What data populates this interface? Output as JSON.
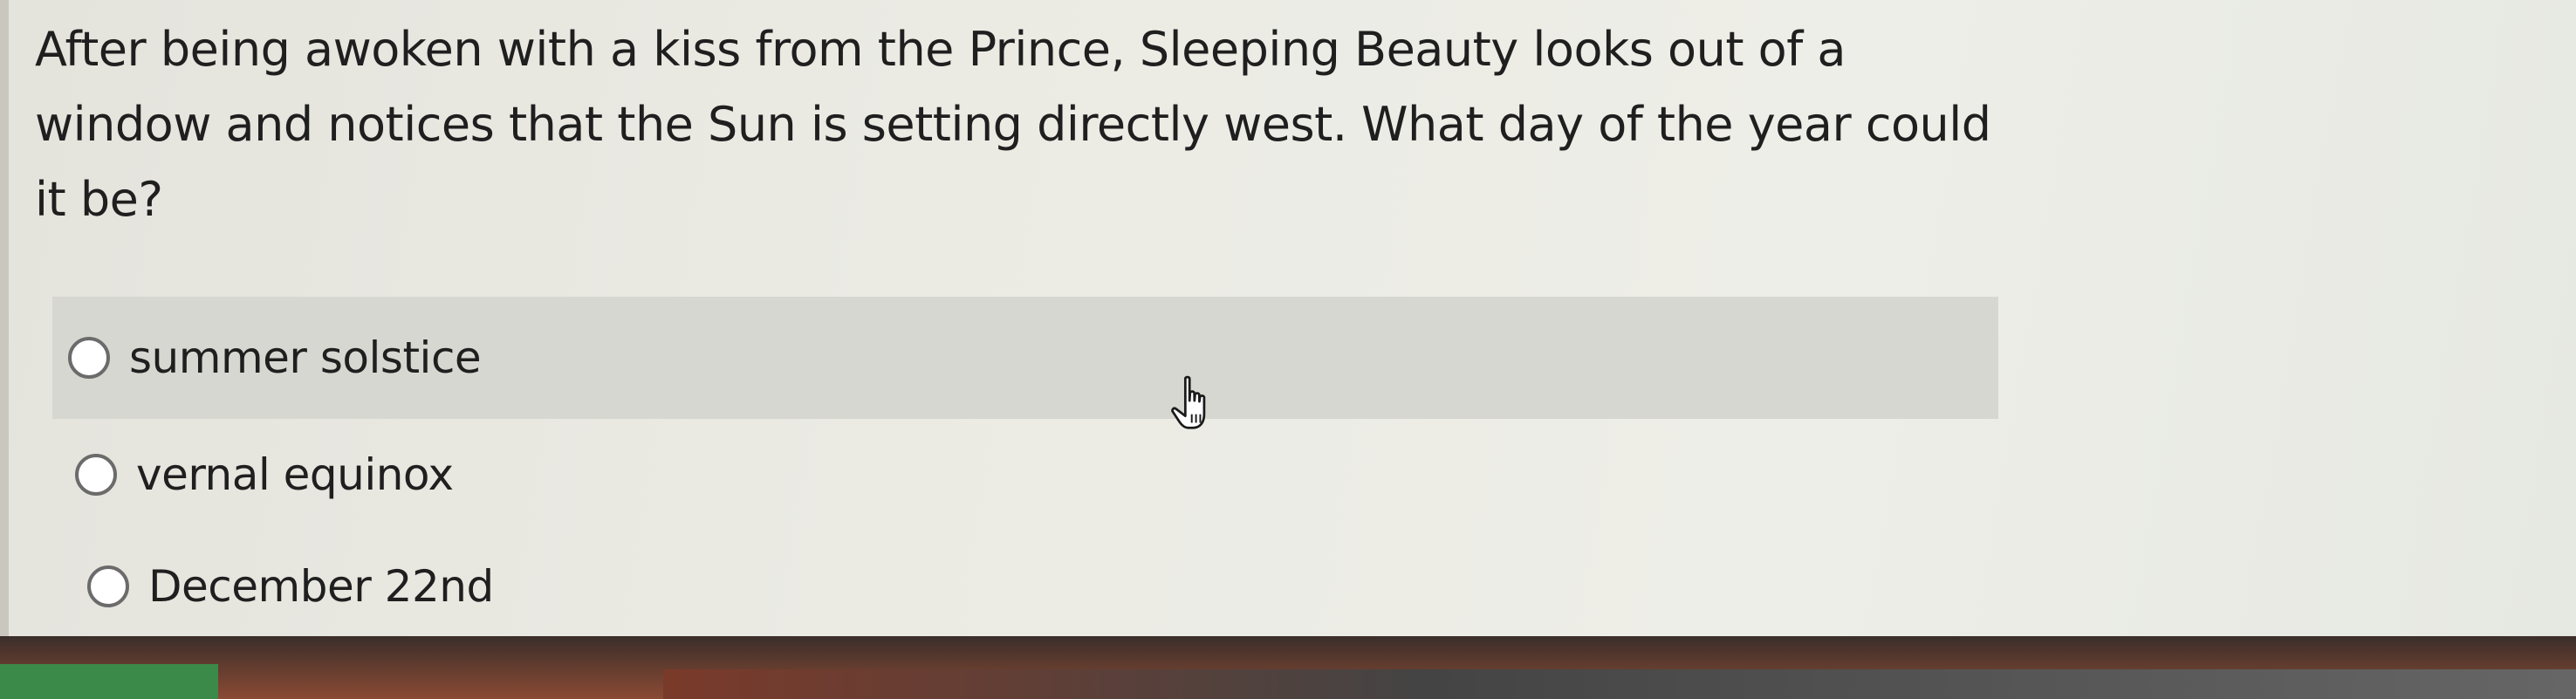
{
  "question": {
    "text": "After being awoken with a kiss from the Prince, Sleeping Beauty looks out of a window and notices that the Sun is setting directly west. What day of the year could it be?"
  },
  "options": [
    {
      "label": "summer solstice",
      "hovered": true
    },
    {
      "label": "vernal equinox",
      "hovered": false
    },
    {
      "label": "December 22nd",
      "hovered": false
    }
  ],
  "cursor": {
    "icon": "hand-pointer-icon"
  }
}
